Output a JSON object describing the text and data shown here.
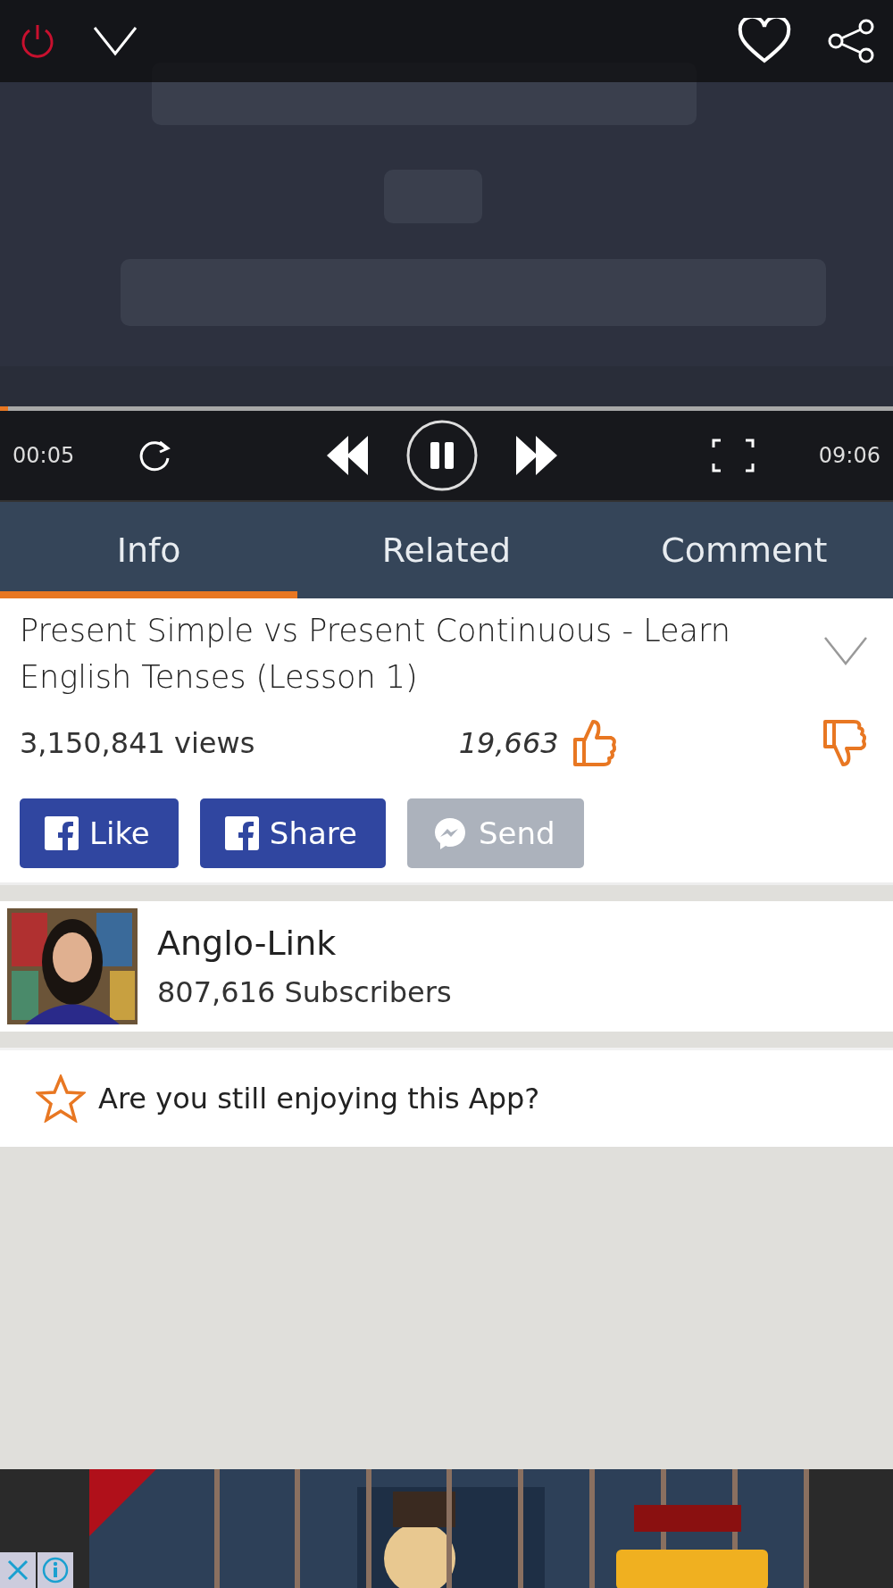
{
  "player": {
    "progress": {
      "level": 0.009
    },
    "elapsed": "00:05",
    "duration": "09:06",
    "playing": true
  },
  "tabs": [
    {
      "label": "Info",
      "selected": true
    },
    {
      "label": "Related",
      "selected": false
    },
    {
      "label": "Comment",
      "selected": false
    }
  ],
  "info": {
    "title": "Present Simple vs Present Continuous - Learn English Tenses (Lesson 1)",
    "views": "3,150,841 views",
    "likes": "19,663"
  },
  "share_buttons": [
    {
      "kind": "facebook",
      "label": "Like",
      "disabled": false
    },
    {
      "kind": "facebook",
      "label": "Share",
      "disabled": false
    },
    {
      "kind": "messenger",
      "label": "Send",
      "disabled": true
    }
  ],
  "channel": {
    "name": "Anglo-Link",
    "subscribers": "807,616 Subscribers"
  },
  "rating_prompt": "Are you still enjoying this App?"
}
